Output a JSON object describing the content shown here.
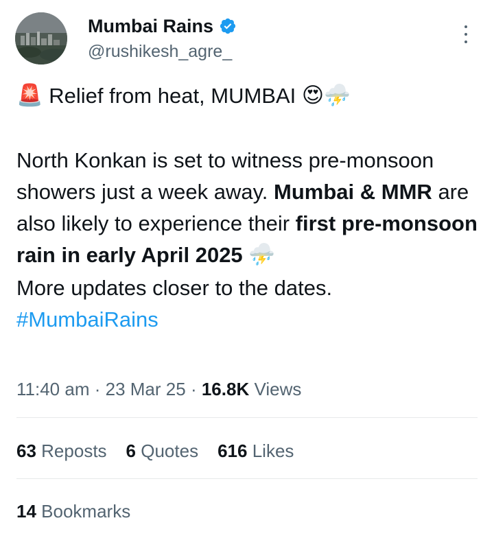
{
  "author": {
    "display_name": "Mumbai Rains",
    "handle": "@rushikesh_agre_",
    "verified_color": "#1d9bf0"
  },
  "tweet": {
    "line1_emoji_siren": "🚨",
    "line1_text": "Relief from heat, MUMBAI",
    "line1_emoji_heart_eyes": "😍",
    "line1_emoji_storm": "⛈️",
    "p2_a": "North Konkan is set to witness pre-monsoon showers just a week away.",
    "p2_b": "Mumbai & MMR",
    "p2_c": "are also likely to experience their",
    "p2_d": "first pre-monsoon rain in early April 2025",
    "p2_emoji_storm": "⛈️",
    "p3": "More updates closer to the dates.",
    "hashtag": "#MumbaiRains"
  },
  "meta": {
    "time": "11:40 am",
    "sep1": "·",
    "date": "23 Mar 25",
    "sep2": "·",
    "views_count": "16.8K",
    "views_label": "Views"
  },
  "stats": {
    "reposts_count": "63",
    "reposts_label": "Reposts",
    "quotes_count": "6",
    "quotes_label": "Quotes",
    "likes_count": "616",
    "likes_label": "Likes"
  },
  "bookmarks": {
    "count": "14",
    "label": "Bookmarks"
  },
  "colors": {
    "text_primary": "#0f1419",
    "text_secondary": "#536471",
    "link": "#1d9bf0",
    "divider": "#e7e9ea"
  }
}
